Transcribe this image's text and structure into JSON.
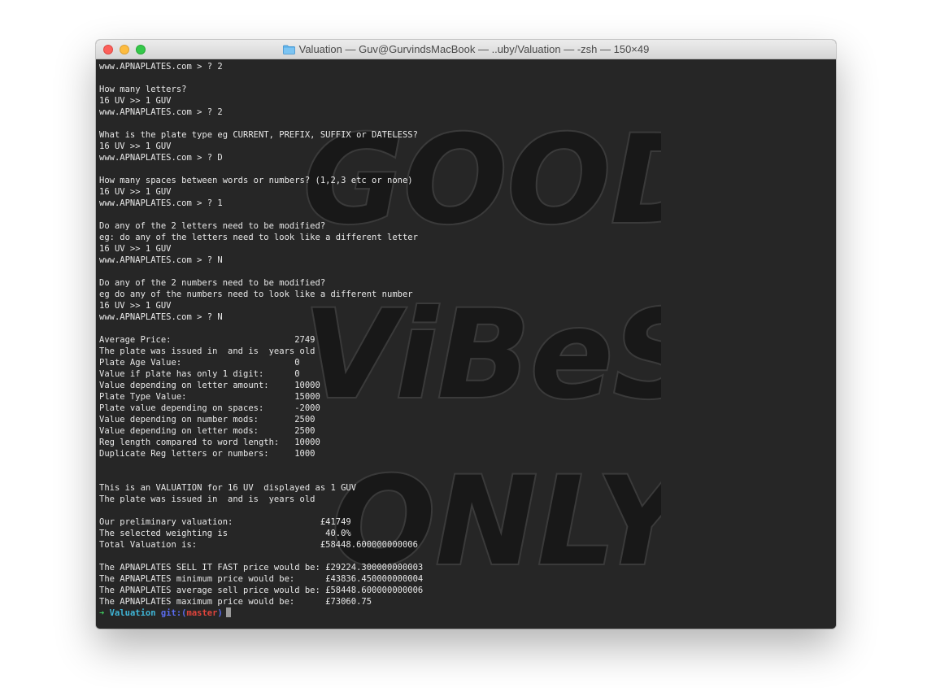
{
  "window": {
    "title": "Valuation — Guv@GurvindsMacBook — ..uby/Valuation — -zsh — 150×49",
    "folder_icon": "folder-icon",
    "buttons": [
      "close-button",
      "minimize-button",
      "zoom-button"
    ]
  },
  "background": {
    "text": [
      "GOOD",
      "ViBeS",
      "ONLY"
    ]
  },
  "lines": [
    "www.APNAPLATES.com > ? 2",
    "",
    "How many letters?",
    "16 UV >> 1 GUV",
    "www.APNAPLATES.com > ? 2",
    "",
    "What is the plate type eg CURRENT, PREFIX, SUFFIX or DATELESS?",
    "16 UV >> 1 GUV",
    "www.APNAPLATES.com > ? D",
    "",
    "How many spaces between words or numbers? (1,2,3 etc or none)",
    "16 UV >> 1 GUV",
    "www.APNAPLATES.com > ? 1",
    "",
    "Do any of the 2 letters need to be modified?",
    "eg: do any of the letters need to look like a different letter",
    "16 UV >> 1 GUV",
    "www.APNAPLATES.com > ? N",
    "",
    "Do any of the 2 numbers need to be modified?",
    "eg do any of the numbers need to look like a different number",
    "16 UV >> 1 GUV",
    "www.APNAPLATES.com > ? N",
    "",
    "Average Price:                        2749",
    "The plate was issued in  and is  years old",
    "Plate Age Value:                      0",
    "Value if plate has only 1 digit:      0",
    "Value depending on letter amount:     10000",
    "Plate Type Value:                     15000",
    "Plate value depending on spaces:      -2000",
    "Value depending on number mods:       2500",
    "Value depending on letter mods:       2500",
    "Reg length compared to word length:   10000",
    "Duplicate Reg letters or numbers:     1000",
    "",
    "",
    "This is an VALUATION for 16 UV  displayed as 1 GUV",
    "The plate was issued in  and is  years old",
    "",
    "Our preliminary valuation:                 £41749",
    "The selected weighting is                   40.0%",
    "Total Valuation is:                        £58448.600000000006",
    "",
    "The APNAPLATES SELL IT FAST price would be: £29224.300000000003",
    "The APNAPLATES minimum price would be:      £43836.450000000004",
    "The APNAPLATES average sell price would be: £58448.600000000006",
    "The APNAPLATES maximum price would be:      £73060.75"
  ],
  "prompt": {
    "arrow": "➜",
    "directory": "Valuation",
    "git_label": "git:(",
    "branch": "master",
    "git_close": ")"
  }
}
